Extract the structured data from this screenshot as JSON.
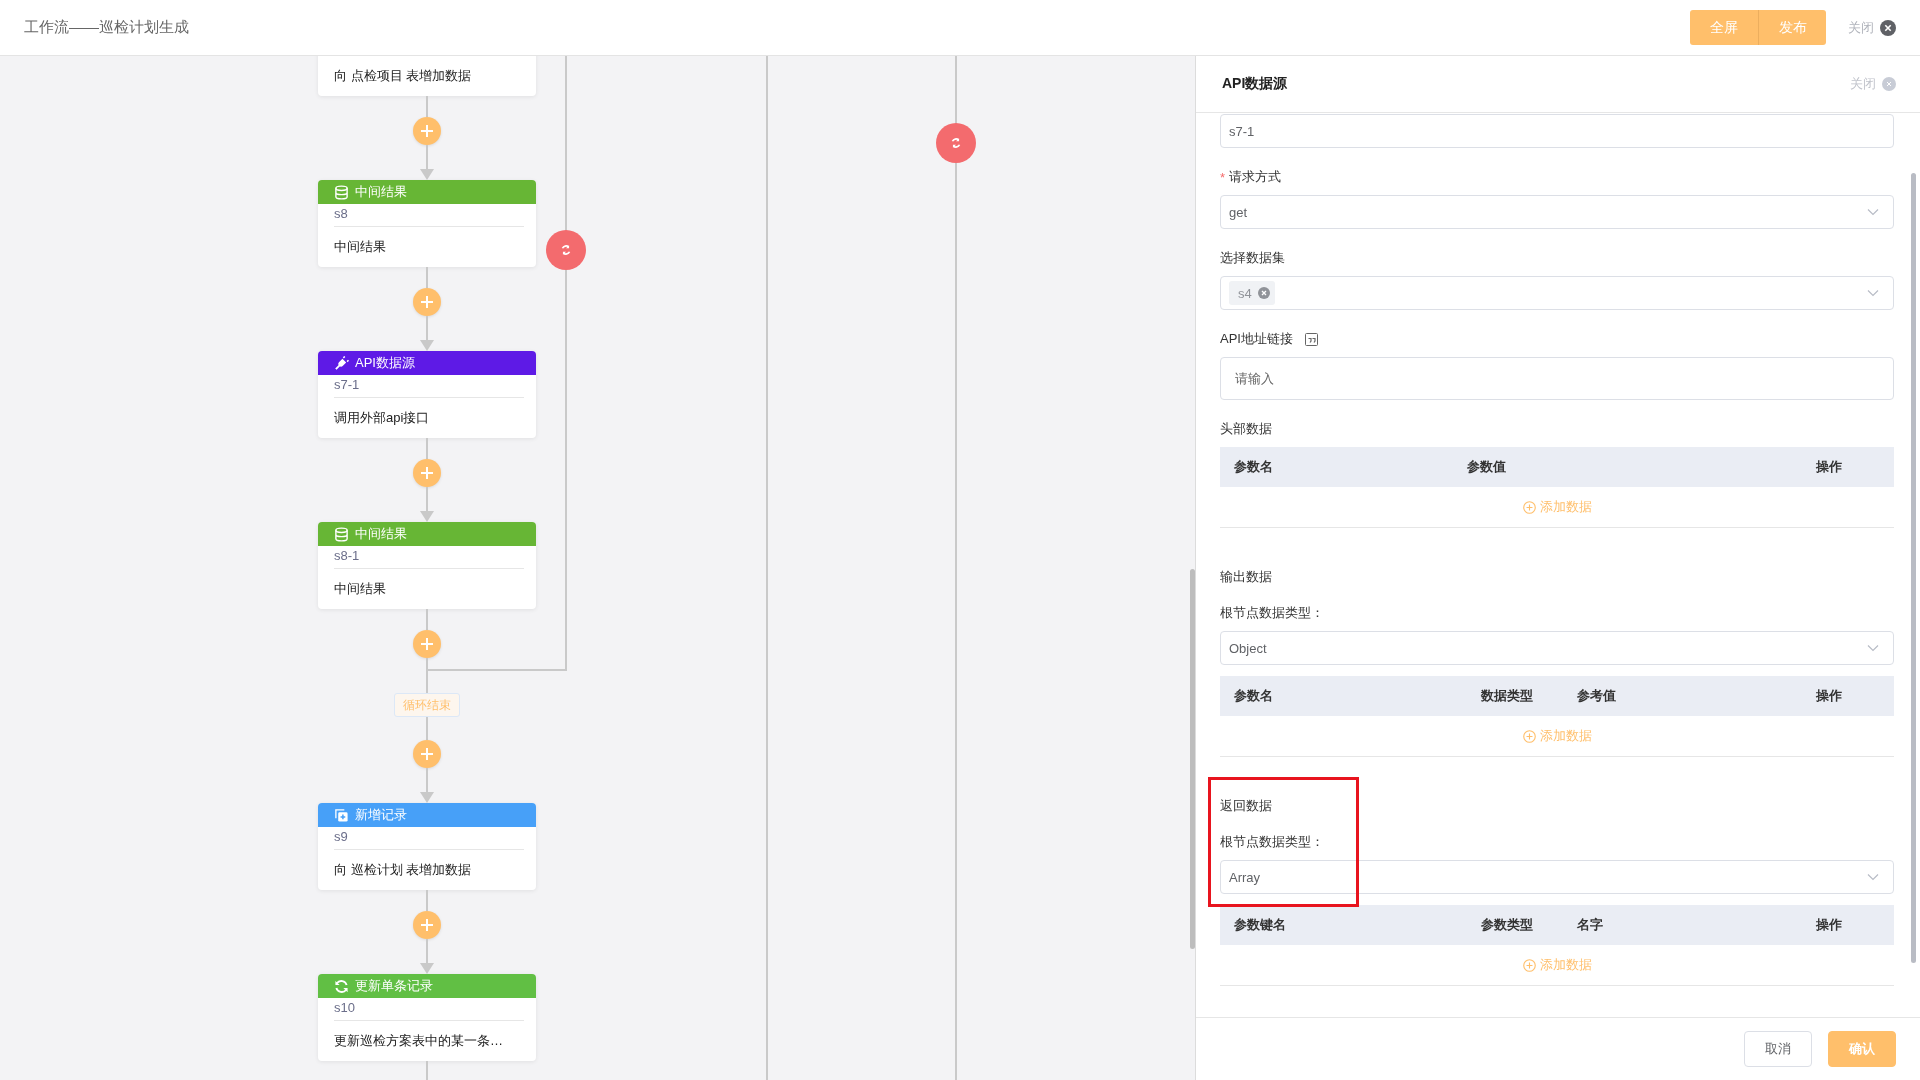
{
  "header": {
    "title": "工作流——巡检计划生成",
    "buttons": [
      "全屏",
      "发布"
    ],
    "close_label": "关闭"
  },
  "canvas": {
    "nodes": [
      {
        "description": "向 点检项目 表增加数据"
      },
      {
        "kind": "result",
        "title": "中间结果",
        "id": "s8",
        "description": "中间结果"
      },
      {
        "kind": "api",
        "title": "API数据源",
        "id": "s7-1",
        "description": "调用外部api接口"
      },
      {
        "kind": "result",
        "title": "中间结果",
        "id": "s8-1",
        "description": "中间结果",
        "loop_end_label": "循环结束"
      },
      {
        "kind": "add",
        "title": "新增记录",
        "id": "s9",
        "description": "向 巡检计划 表增加数据"
      },
      {
        "kind": "update",
        "title": "更新单条记录",
        "id": "s10",
        "description": "更新巡检方案表中的某一条…"
      }
    ]
  },
  "panel": {
    "title": "API数据源",
    "close_label": "关闭",
    "items": [
      {
        "kind": "input",
        "value": "s7-1"
      },
      {
        "kind": "select",
        "required_mark": "*",
        "label": "请求方式",
        "value": "get"
      },
      {
        "kind": "tags",
        "label": "选择数据集",
        "tags": [
          "s4"
        ]
      },
      {
        "kind": "input",
        "label": "API地址链接",
        "help_icon": true,
        "placeholder": "请输入"
      },
      {
        "kind": "table",
        "label": "头部数据",
        "columns": [
          "参数名",
          "参数值",
          "操作"
        ],
        "add_label": "添加数据"
      },
      {
        "kind": "heading",
        "label": "输出数据"
      },
      {
        "kind": "select",
        "label": "根节点数据类型：",
        "value": "Object"
      },
      {
        "kind": "table",
        "columns": [
          "参数名",
          "数据类型",
          "参考值",
          "操作"
        ],
        "add_label": "添加数据"
      },
      {
        "kind": "heading",
        "label": "返回数据"
      },
      {
        "kind": "select",
        "label": "根节点数据类型：",
        "value": "Array"
      },
      {
        "kind": "table",
        "columns": [
          "参数键名",
          "参数类型",
          "名字",
          "操作"
        ],
        "add_label": "添加数据"
      }
    ],
    "buttons": [
      {
        "label": "取消",
        "kind": "secondary"
      },
      {
        "label": "确认",
        "kind": "primary"
      }
    ]
  }
}
